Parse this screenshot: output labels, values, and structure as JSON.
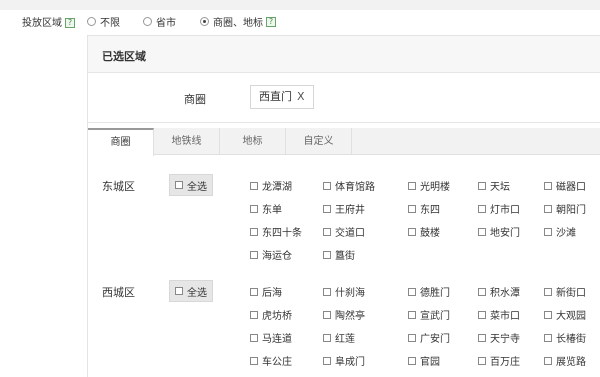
{
  "area": {
    "label": "投放区域",
    "help": "?",
    "options": [
      {
        "label": "不限",
        "checked": false
      },
      {
        "label": "省市",
        "checked": false
      },
      {
        "label": "商圈、地标",
        "checked": true
      }
    ]
  },
  "panel": {
    "title": "已选区域",
    "selected_label": "商圈",
    "chips": [
      {
        "label": "西直门",
        "remove": "X"
      }
    ]
  },
  "tabs": [
    "商圈",
    "地铁线",
    "地标",
    "自定义"
  ],
  "districts": [
    {
      "name": "东城区",
      "select_all": "全选",
      "rows": [
        [
          "龙潭湖",
          "体育馆路",
          "光明楼",
          "天坛",
          "磁器口"
        ],
        [
          "东单",
          "王府井",
          "东四",
          "灯市口",
          "朝阳门"
        ],
        [
          "东四十条",
          "交道口",
          "鼓楼",
          "地安门",
          "沙滩"
        ],
        [
          "海运仓",
          "簋街"
        ]
      ]
    },
    {
      "name": "西城区",
      "select_all": "全选",
      "rows": [
        [
          "后海",
          "什刹海",
          "德胜门",
          "积水潭",
          "新街口"
        ],
        [
          "虎坊桥",
          "陶然亭",
          "宣武门",
          "菜市口",
          "大观园"
        ],
        [
          "马连道",
          "红莲",
          "广安门",
          "天宁寺",
          "长椿街"
        ],
        [
          "车公庄",
          "阜成门",
          "官园",
          "百万庄",
          "展览路"
        ]
      ]
    }
  ]
}
